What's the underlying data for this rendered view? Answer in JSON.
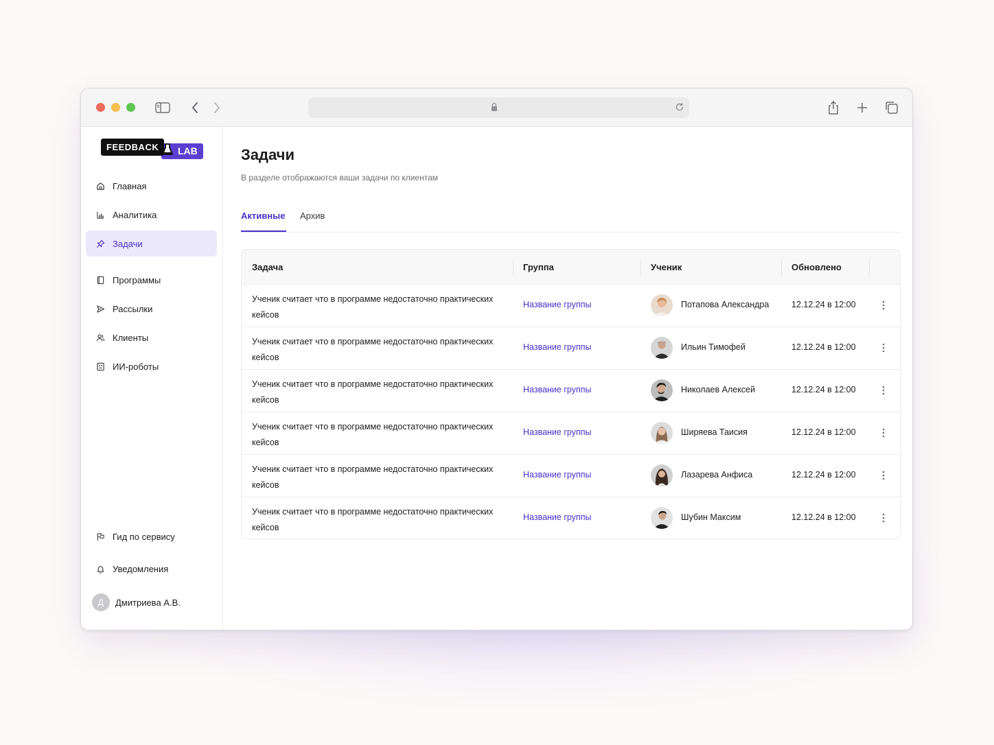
{
  "app": {
    "logo_part1": "FEEDBACK",
    "logo_part2": "LAB",
    "accent": "#4a30c9",
    "brand_purple": "#5b3fd1"
  },
  "browser": {
    "icons": [
      "sidebar-toggle-icon",
      "back-icon",
      "forward-icon",
      "lock-icon",
      "reload-icon",
      "share-icon",
      "new-tab-icon",
      "tabs-overview-icon"
    ]
  },
  "sidebar": {
    "items": [
      {
        "label": "Главная",
        "icon": "home-icon"
      },
      {
        "label": "Аналитика",
        "icon": "chart-icon"
      },
      {
        "label": "Задачи",
        "icon": "pin-icon",
        "active": true
      },
      {
        "label": "Программы",
        "icon": "book-icon"
      },
      {
        "label": "Рассылки",
        "icon": "send-icon"
      },
      {
        "label": "Клиенты",
        "icon": "users-icon"
      },
      {
        "label": "ИИ-роботы",
        "icon": "robot-icon"
      }
    ],
    "bottom": {
      "guide": "Гид по сервису",
      "notifications": "Уведомления",
      "user_initial": "Д",
      "user_name": "Дмитриева А.В."
    }
  },
  "main": {
    "title": "Задачи",
    "subtitle": "В разделе отображаются ваши задачи по клиентам",
    "tabs": [
      {
        "label": "Активные",
        "active": true
      },
      {
        "label": "Архив",
        "active": false
      }
    ],
    "table": {
      "headers": [
        "Задача",
        "Группа",
        "Ученик",
        "Обновлено"
      ],
      "rows": [
        {
          "task": "Ученик считает что в программе недостаточно практических кейсов",
          "group": "Название группы",
          "student": "Потапова Александра",
          "updated": "12.12.24 в 12:00"
        },
        {
          "task": "Ученик считает что в программе недостаточно практических кейсов",
          "group": "Название группы",
          "student": "Ильин Тимофей",
          "updated": "12.12.24 в 12:00"
        },
        {
          "task": "Ученик считает что в программе недостаточно практических кейсов",
          "group": "Название группы",
          "student": "Николаев Алексей",
          "updated": "12.12.24 в 12:00"
        },
        {
          "task": "Ученик считает что в программе недостаточно практических кейсов",
          "group": "Название группы",
          "student": "Ширяева Таисия",
          "updated": "12.12.24 в 12:00"
        },
        {
          "task": "Ученик считает что в программе недостаточно практических кейсов",
          "group": "Название группы",
          "student": "Лазарева Анфиса",
          "updated": "12.12.24 в 12:00"
        },
        {
          "task": "Ученик считает что в программе недостаточно практических кейсов",
          "group": "Название группы",
          "student": "Шубин Максим",
          "updated": "12.12.24 в 12:00"
        }
      ]
    }
  }
}
